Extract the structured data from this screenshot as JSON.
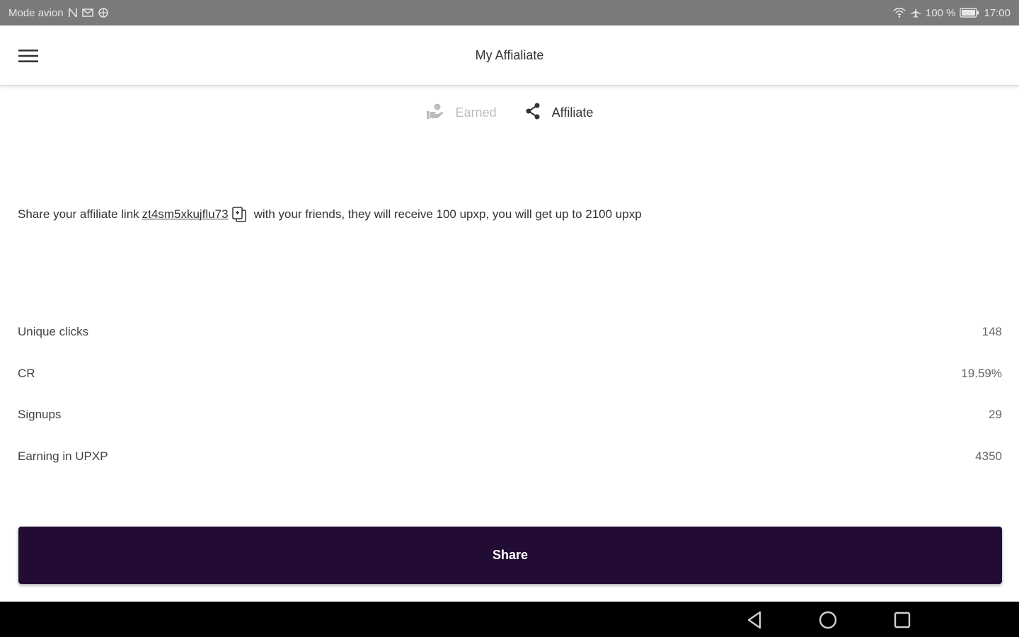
{
  "status_bar": {
    "left_text": "Mode avion",
    "battery_text": "100 %",
    "time": "17:00",
    "icons": [
      "nfc-icon",
      "mail-icon",
      "airplane-mode-icon",
      "wifi-icon",
      "airplane-icon",
      "battery-icon"
    ]
  },
  "app_bar": {
    "title": "My Affialiate",
    "menu_icon": "hamburger-menu-icon"
  },
  "tabs": [
    {
      "label": "Earned",
      "icon": "earned-icon",
      "active": false
    },
    {
      "label": "Affiliate",
      "icon": "share-icon",
      "active": true
    }
  ],
  "share_info": {
    "prefix": "Share your affiliate link",
    "link": "zt4sm5xkujflu73",
    "suffix": "with your friends, they will receive 100 upxp, you will get up to 2100 upxp"
  },
  "stats": [
    {
      "label": "Unique clicks",
      "value": "148"
    },
    {
      "label": "CR",
      "value": "19.59%"
    },
    {
      "label": "Signups",
      "value": "29"
    },
    {
      "label": "Earning in UPXP",
      "value": "4350"
    }
  ],
  "share_button": {
    "label": "Share"
  },
  "colors": {
    "status_bar": "#7a7a7a",
    "primary_button": "#220c33",
    "nav_bar": "#000000",
    "inactive_tab": "#bdbdbd"
  }
}
